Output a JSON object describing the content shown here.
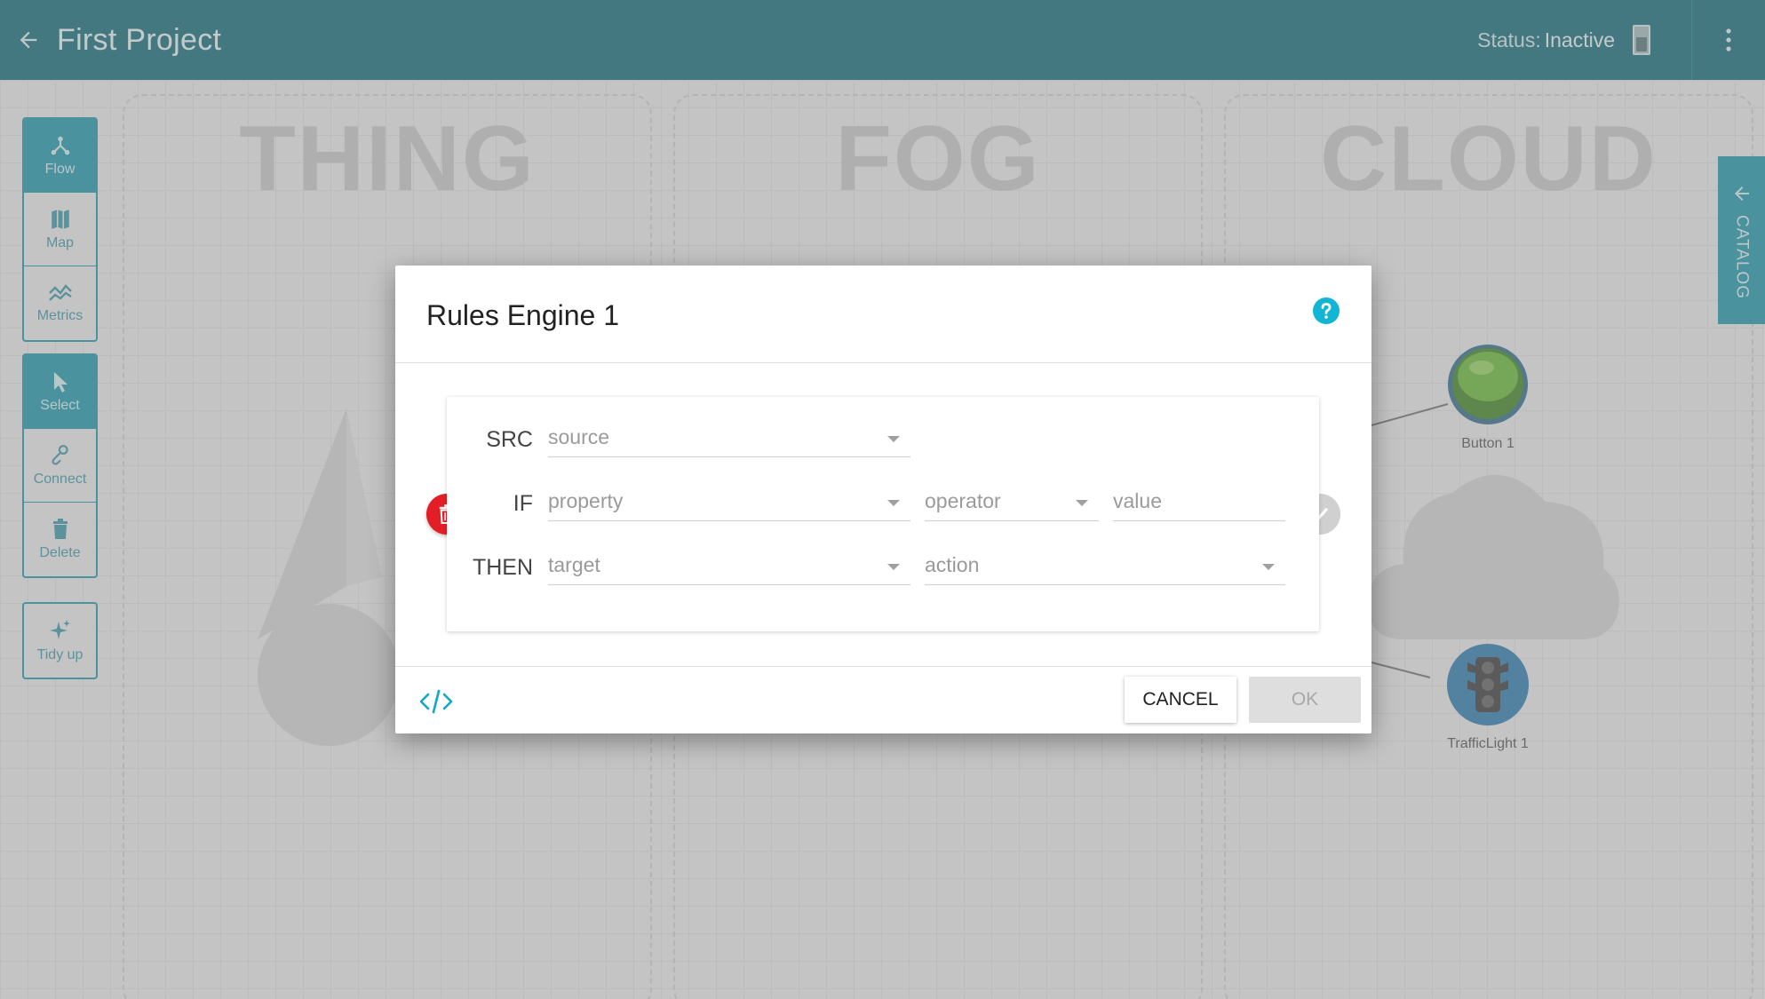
{
  "header": {
    "title": "First Project",
    "status_label": "Status:",
    "status_value": "Inactive"
  },
  "zones": [
    "THING",
    "FOG",
    "CLOUD"
  ],
  "toolbar": {
    "view": [
      {
        "label": "Flow",
        "icon": "flow-icon",
        "active": true
      },
      {
        "label": "Map",
        "icon": "map-icon",
        "active": false
      },
      {
        "label": "Metrics",
        "icon": "metrics-icon",
        "active": false
      }
    ],
    "edit": [
      {
        "label": "Select",
        "icon": "cursor-icon",
        "active": true
      },
      {
        "label": "Connect",
        "icon": "link-icon",
        "active": false
      },
      {
        "label": "Delete",
        "icon": "trash-icon",
        "active": false
      }
    ],
    "tidy": {
      "label": "Tidy up",
      "icon": "sparkle-icon"
    }
  },
  "catalog": {
    "label": "CATALOG"
  },
  "nodes": {
    "button": {
      "label": "Button 1"
    },
    "traffic_light": {
      "label": "TrafficLight 1"
    }
  },
  "dialog": {
    "title": "Rules Engine 1",
    "rule": {
      "src_label": "SRC",
      "if_label": "IF",
      "then_label": "THEN",
      "source_placeholder": "source",
      "property_placeholder": "property",
      "operator_placeholder": "operator",
      "value_placeholder": "value",
      "target_placeholder": "target",
      "action_placeholder": "action"
    },
    "cancel_label": "CANCEL",
    "ok_label": "OK"
  },
  "colors": {
    "header": "#00606f",
    "accent": "#0c8ea3",
    "delete": "#e41e26",
    "help": "#12b5d4"
  }
}
